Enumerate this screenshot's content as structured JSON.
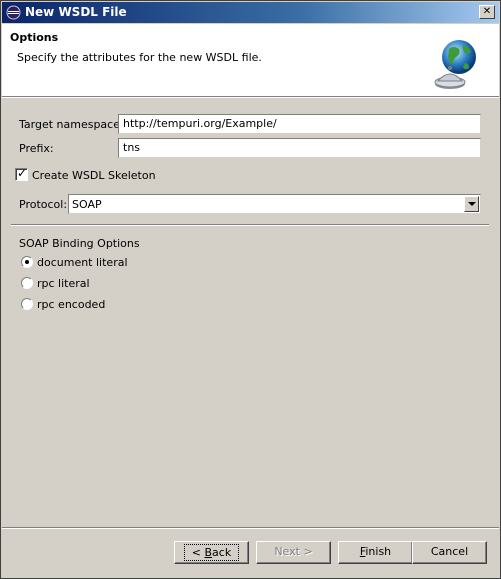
{
  "window": {
    "title": "New WSDL File"
  },
  "header": {
    "title": "Options",
    "description": "Specify the attributes for the new WSDL file."
  },
  "form": {
    "target_namespace_label": "Target namespace:",
    "target_namespace_value": "http://tempuri.org/Example/",
    "prefix_label": "Prefix:",
    "prefix_value": "tns",
    "create_skeleton_label": "Create WSDL Skeleton",
    "create_skeleton_checked": true,
    "protocol_label": "Protocol:",
    "protocol_value": "SOAP"
  },
  "binding": {
    "group_label": "SOAP Binding Options",
    "options": [
      {
        "label": "document literal",
        "selected": true
      },
      {
        "label": "rpc literal",
        "selected": false
      },
      {
        "label": "rpc encoded",
        "selected": false
      }
    ]
  },
  "buttons": {
    "back_prefix": "< ",
    "back_mnemonic": "B",
    "back_rest": "ack",
    "next": "Next >",
    "finish_mnemonic": "F",
    "finish_rest": "inish",
    "cancel": "Cancel"
  },
  "colors": {
    "title_bar_start": "#0a246a",
    "title_bar_end": "#a6caf0",
    "dialog_face": "#d4d0c8"
  },
  "icons": {
    "app": "eclipse-icon",
    "banner": "globe-wsdl-icon"
  }
}
